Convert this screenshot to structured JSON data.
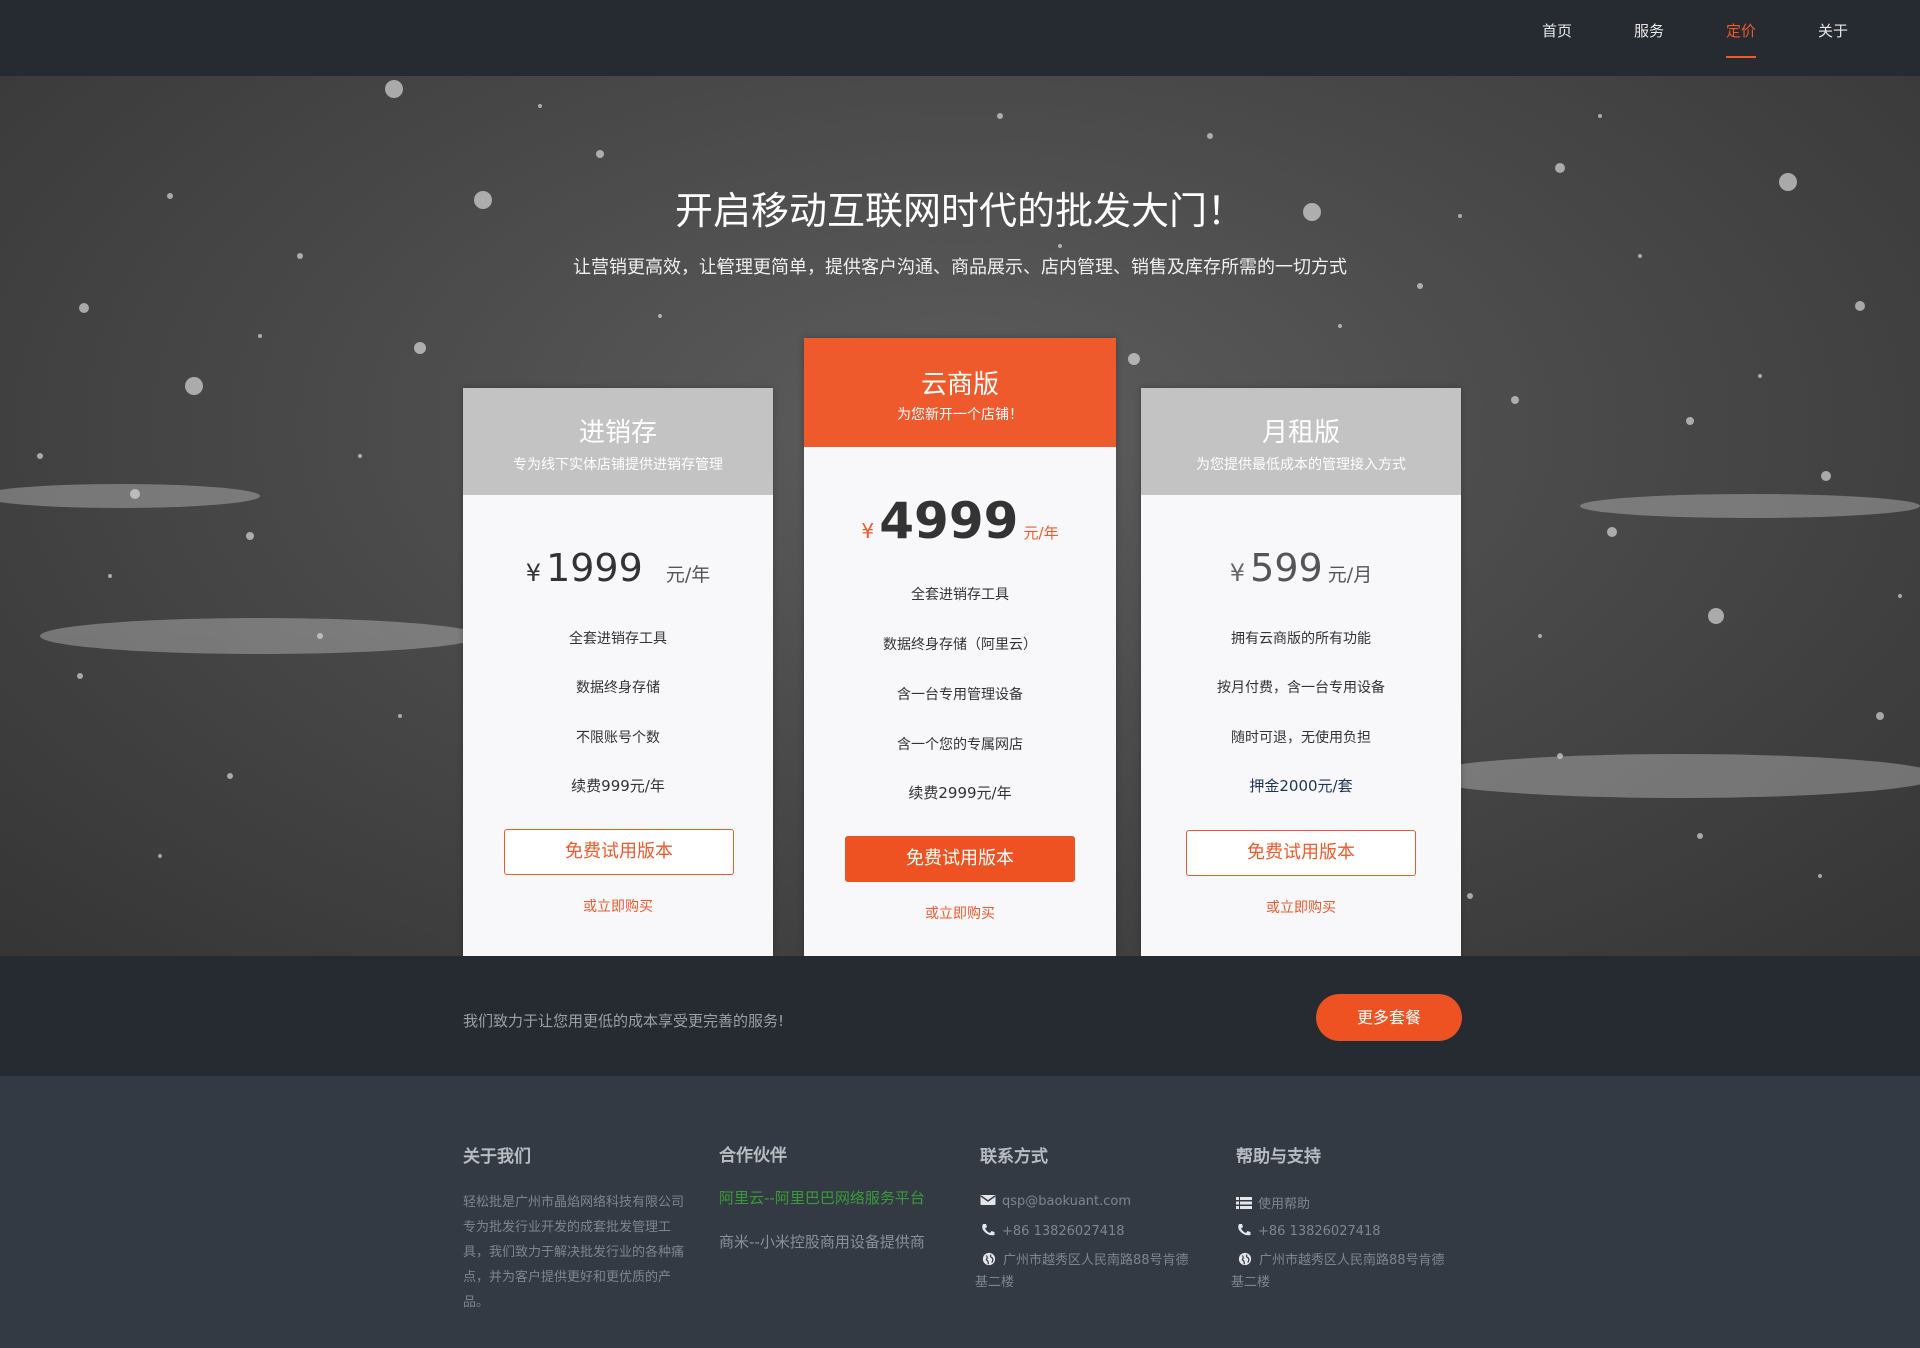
{
  "nav": {
    "items": [
      {
        "label": "首页",
        "active": false
      },
      {
        "label": "服务",
        "active": false
      },
      {
        "label": "定价",
        "active": true
      },
      {
        "label": "关于",
        "active": false
      }
    ]
  },
  "hero": {
    "title": "开启移动互联网时代的批发大门！",
    "subtitle": "让营销更高效，让管理更简单，提供客户沟通、商品展示、店内管理、销售及库存所需的一切方式"
  },
  "plans": [
    {
      "name": "进销存",
      "tagline": "专为线下实体店铺提供进销存管理",
      "currency": "¥",
      "amount": "1999",
      "unit": "元/年",
      "features": [
        "全套进销存工具",
        "数据终身存储",
        "不限账号个数",
        "续费999元/年"
      ],
      "cta": "免费试用版本",
      "buy": "或立即购买"
    },
    {
      "name": "云商版",
      "tagline": "为您新开一个店铺！",
      "currency": "¥",
      "amount": "4999",
      "unit": "元/年",
      "features": [
        "全套进销存工具",
        "数据终身存储（阿里云）",
        "含一台专用管理设备",
        "含一个您的专属网店",
        "续费2999元/年"
      ],
      "cta": "免费试用版本",
      "buy": "或立即购买"
    },
    {
      "name": "月租版",
      "tagline": "为您提供最低成本的管理接入方式",
      "currency": "¥",
      "amount": "599",
      "unit": "元/月",
      "features": [
        "拥有云商版的所有功能",
        "按月付费，含一台专用设备",
        "随时可退，无使用负担",
        "押金2000元/套"
      ],
      "cta": "免费试用版本",
      "buy": "或立即购买"
    }
  ],
  "banner": {
    "text": "我们致力于让您用更低的成本享受更完善的服务!",
    "button": "更多套餐"
  },
  "footer": {
    "about": {
      "heading": "关于我们",
      "text": "轻松批是广州市晶焰网络科技有限公司专为批发行业开发的成套批发管理工具，我们致力于解决批发行业的各种痛点，并为客户提供更好和更优质的产品。"
    },
    "partners": {
      "heading": "合作伙伴",
      "links": [
        "阿里云--阿里巴巴网络服务平台",
        "商米--小米控股商用设备提供商"
      ]
    },
    "contact": {
      "heading": "联系方式",
      "email": "qsp@baokuant.com",
      "phone": "+86 13826027418",
      "address": "广州市越秀区人民南路88号肯德基二楼"
    },
    "help": {
      "heading": "帮助与支持",
      "usage": "使用帮助",
      "phone": "+86 13826027418",
      "address": "广州市越秀区人民南路88号肯德基二楼"
    }
  },
  "colors": {
    "accent": "#ef5a2c",
    "nav_bg": "#262a31",
    "footer_bg": "#343a43",
    "card_head_gray": "#c3c3c3",
    "partner_link_green": "#3a9a3a"
  },
  "icons": [
    "email-icon",
    "phone-icon",
    "globe-icon",
    "list-icon"
  ]
}
